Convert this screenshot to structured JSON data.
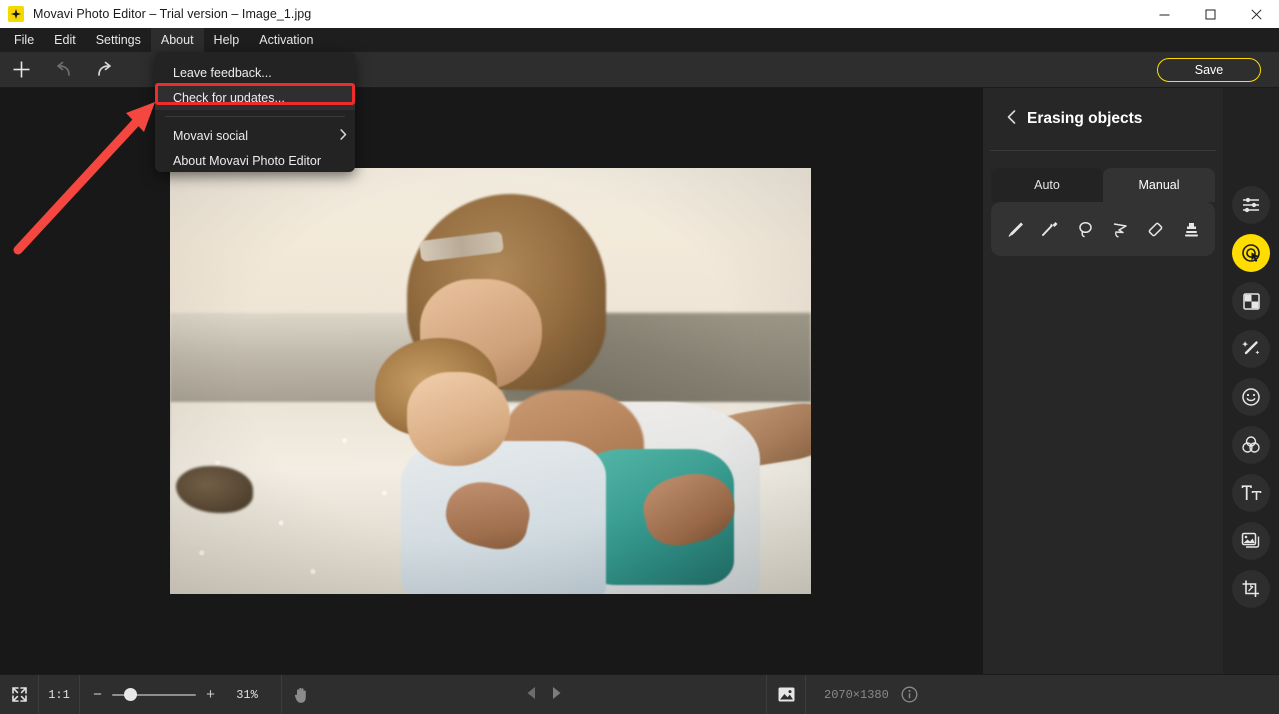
{
  "window": {
    "title": "Movavi Photo Editor – Trial version – Image_1.jpg",
    "app_icon": "movavi-logo-icon",
    "controls": {
      "minimize": "minimize-icon",
      "maximize": "maximize-icon",
      "close": "close-icon"
    }
  },
  "menubar": {
    "items": [
      {
        "label": "File",
        "active": false
      },
      {
        "label": "Edit",
        "active": false
      },
      {
        "label": "Settings",
        "active": false
      },
      {
        "label": "About",
        "active": true
      },
      {
        "label": "Help",
        "active": false
      },
      {
        "label": "Activation",
        "active": false
      }
    ]
  },
  "dropdown": {
    "open_for": "About",
    "items": [
      {
        "label": "Leave feedback...",
        "highlighted": false,
        "submenu": false
      },
      {
        "label": "Check for updates...",
        "highlighted": true,
        "submenu": false
      },
      {
        "label": "Movavi social",
        "highlighted": false,
        "submenu": true
      },
      {
        "label": "About Movavi Photo Editor",
        "highlighted": false,
        "submenu": false
      }
    ],
    "submenu_arrow": "chevron-right-icon"
  },
  "annotation": {
    "highlight_color": "#ef2c2c",
    "arrow_color": "#f4473f",
    "target_label": "Check for updates..."
  },
  "toolbar": {
    "add_icon": "plus-icon",
    "undo_icon": "undo-arrow-icon",
    "redo_icon": "redo-arrow-icon",
    "save_label": "Save",
    "save_accent": "#ffdd00"
  },
  "right_panel": {
    "back_icon": "chevron-left-icon",
    "title": "Erasing objects",
    "tabs": [
      {
        "label": "Auto",
        "active": false
      },
      {
        "label": "Manual",
        "active": true
      }
    ],
    "tools": [
      {
        "name": "brush-tool-icon"
      },
      {
        "name": "magic-wand-tool-icon"
      },
      {
        "name": "lasso-tool-icon"
      },
      {
        "name": "polygonal-lasso-tool-icon"
      },
      {
        "name": "eraser-tool-icon"
      },
      {
        "name": "stamp-tool-icon"
      }
    ]
  },
  "right_rail": {
    "active_accent": "#ffdd00",
    "items": [
      {
        "name": "adjustments-icon",
        "active": false
      },
      {
        "name": "object-removal-icon",
        "active": true
      },
      {
        "name": "background-removal-icon",
        "active": false
      },
      {
        "name": "magic-retouch-icon",
        "active": false
      },
      {
        "name": "face-retouch-icon",
        "active": false
      },
      {
        "name": "color-effects-icon",
        "active": false
      },
      {
        "name": "text-tool-icon",
        "active": false
      },
      {
        "name": "insert-image-icon",
        "active": false
      },
      {
        "name": "crop-tool-icon",
        "active": false
      }
    ]
  },
  "bottom_bar": {
    "fit_icon": "fit-to-screen-icon",
    "actual_size_label": "1:1",
    "zoom_out_label": "−",
    "zoom_in_label": "+",
    "zoom_level": "31%",
    "slider_position_pct": 18,
    "hand_tool_icon": "hand-tool-icon",
    "prev_icon": "previous-triangle-icon",
    "next_icon": "next-triangle-icon",
    "compare_icon": "compare-image-icon",
    "image_size": "2070×1380",
    "info_icon": "info-icon"
  },
  "canvas": {
    "background": "#181818",
    "photo_alt": "woman carrying a child at the beach at sunset"
  }
}
